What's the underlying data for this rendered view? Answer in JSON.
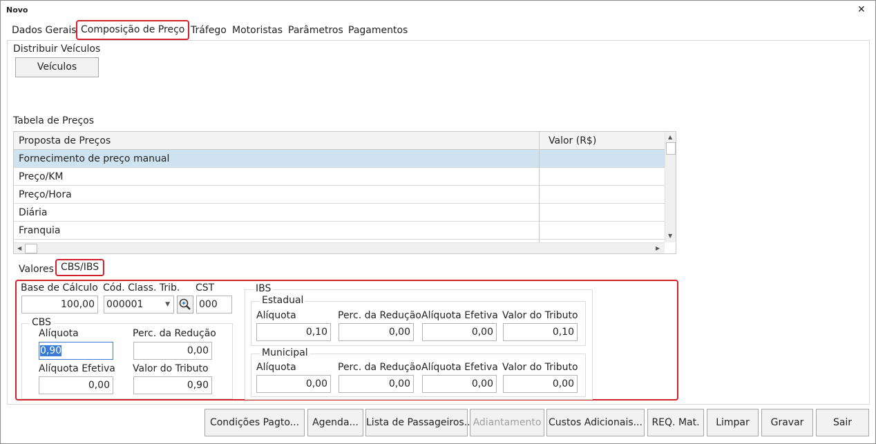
{
  "window": {
    "title": "Novo",
    "close_glyph": "✕"
  },
  "tabs": [
    "Dados Gerais",
    "Composição de Preço",
    "Tráfego",
    "Motoristas",
    "Parâmetros",
    "Pagamentos"
  ],
  "distribuir": {
    "label": "Distribuir Veículos",
    "button": "Veículos"
  },
  "tabela": {
    "label": "Tabela de Preços",
    "columns": [
      "Proposta de Preços",
      "Valor (R$)"
    ],
    "rows": [
      {
        "proposta": "Fornecimento de preço manual",
        "valor": ""
      },
      {
        "proposta": "Preço/KM",
        "valor": ""
      },
      {
        "proposta": "Preço/Hora",
        "valor": ""
      },
      {
        "proposta": "Diária",
        "valor": ""
      },
      {
        "proposta": "Franquia",
        "valor": ""
      }
    ]
  },
  "subtabs": [
    "Valores",
    "CBS/IBS"
  ],
  "cbsibs": {
    "base_label": "Base de Cálculo",
    "base_value": "100,00",
    "cod_label": "Cód. Class. Trib.",
    "cod_value": "000001",
    "cst_label": "CST",
    "cst_value": "000",
    "cbs": {
      "title": "CBS",
      "aliquota_label": "Alíquota",
      "aliquota_value": "0,90",
      "perc_label": "Perc. da Redução",
      "perc_value": "0,00",
      "efetiva_label": "Alíquota Efetiva",
      "efetiva_value": "0,00",
      "tributo_label": "Valor do Tributo",
      "tributo_value": "0,90"
    },
    "ibs": {
      "title": "IBS",
      "estadual": {
        "title": "Estadual",
        "aliquota_label": "Alíquota",
        "aliquota_value": "0,10",
        "perc_label": "Perc. da Redução",
        "perc_value": "0,00",
        "efetiva_label": "Alíquota Efetiva",
        "efetiva_value": "0,00",
        "tributo_label": "Valor do Tributo",
        "tributo_value": "0,10"
      },
      "municipal": {
        "title": "Municipal",
        "aliquota_label": "Alíquota",
        "aliquota_value": "0,00",
        "perc_label": "Perc. da Redução",
        "perc_value": "0,00",
        "efetiva_label": "Alíquota Efetiva",
        "efetiva_value": "0,00",
        "tributo_label": "Valor do Tributo",
        "tributo_value": "0,00"
      }
    }
  },
  "footer": [
    "Condições Pagto...",
    "Agenda...",
    "Lista de Passageiros...",
    "Adiantamento",
    "Custos Adicionais...",
    "REQ. Mat.",
    "Limpar",
    "Gravar",
    "Sair"
  ],
  "icons": {
    "zoom": "magnifier-plus-icon",
    "dropdown": "chevron-down-icon"
  },
  "colors": {
    "highlight": "#d0202a",
    "selected_row": "#cfe2f0",
    "selected_text_bg": "#3a7bd5"
  }
}
